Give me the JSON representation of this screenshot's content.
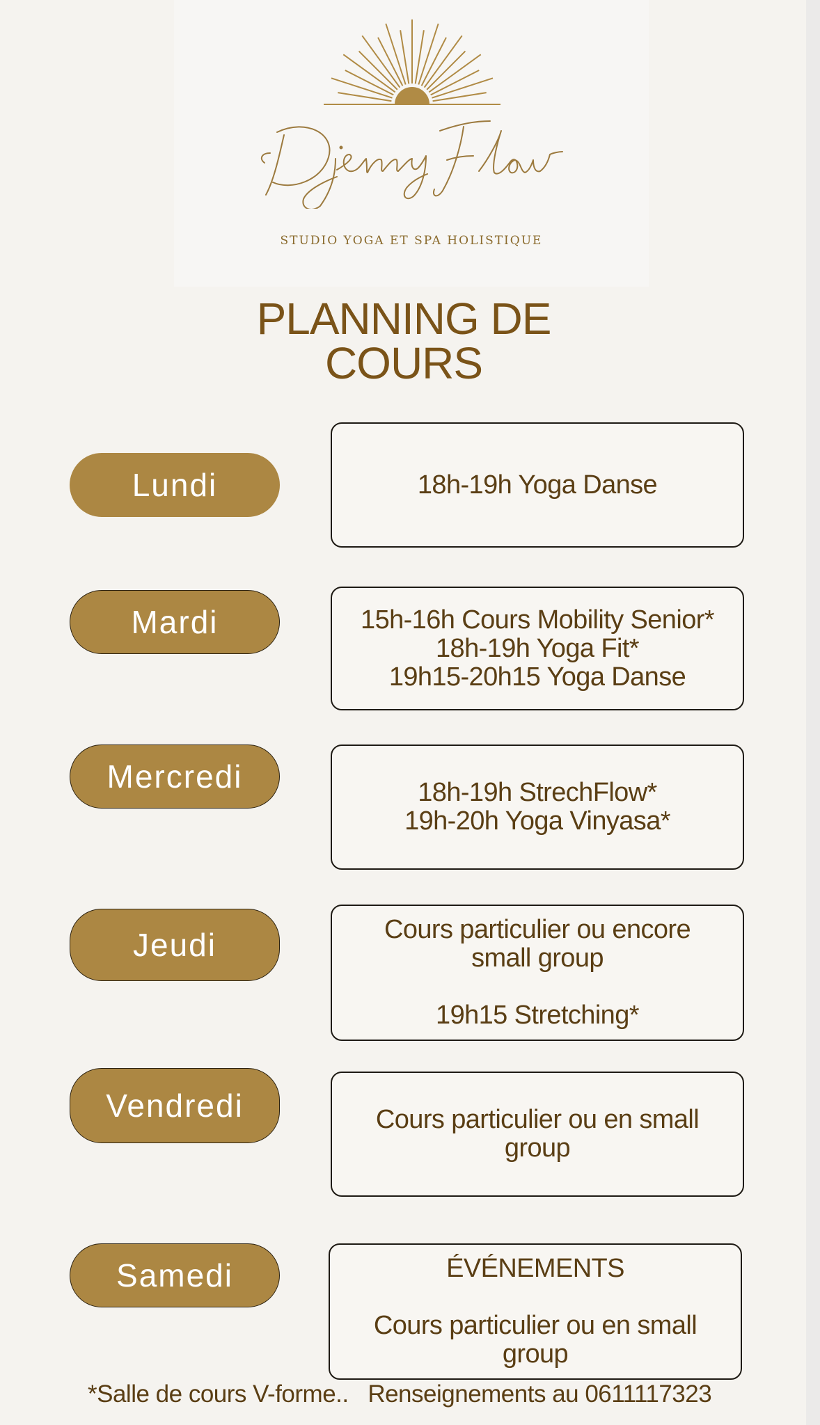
{
  "logo": {
    "script_name": "Djenny Flow",
    "tagline": "STUDIO YOGA ET SPA HOLISTIQUE",
    "icon": "sunburst-icon"
  },
  "title": {
    "line1": "PLANNING DE",
    "line2": "COURS"
  },
  "schedule": [
    {
      "day": "Lundi",
      "lines": [
        "18h-19h Yoga Danse"
      ]
    },
    {
      "day": "Mardi",
      "lines": [
        "15h-16h Cours Mobility Senior*",
        "18h-19h Yoga Fit*",
        "19h15-20h15 Yoga Danse"
      ]
    },
    {
      "day": "Mercredi",
      "lines": [
        "18h-19h StrechFlow*",
        "19h-20h Yoga Vinyasa*"
      ]
    },
    {
      "day": "Jeudi",
      "lines": [
        "Cours particulier ou encore",
        "small group",
        "",
        "19h15 Stretching*"
      ]
    },
    {
      "day": "Vendredi",
      "lines": [
        "Cours particulier ou en small",
        "group"
      ]
    },
    {
      "day": "Samedi",
      "lines": [
        "ÉVÉNEMENTS",
        "",
        "Cours particulier ou en small",
        "group"
      ]
    }
  ],
  "footer": {
    "note": "*Salle de cours V-forme..",
    "contact": "Renseignements au 0611117323"
  },
  "colors": {
    "accent": "#ac8743",
    "text_brown": "#5a3e14",
    "background": "#f5f3ef"
  }
}
